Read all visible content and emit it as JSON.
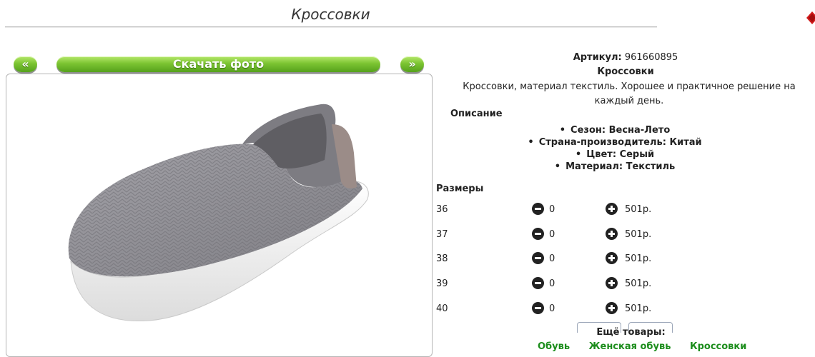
{
  "page": {
    "title": "Кроссовки"
  },
  "gallery": {
    "prev_label": "«",
    "next_label": "»",
    "download_label": "Скачать фото",
    "image_alt": "Кроссовки"
  },
  "product": {
    "article_label": "Артикул:",
    "article_value": "961660895",
    "name": "Кроссовки",
    "description": "Кроссовки, материал текстиль. Хорошее и практичное решение на каждый день.",
    "description_heading": "Описание",
    "features": [
      "Сезон: Весна-Лето",
      "Страна-производитель: Китай",
      "Цвет: Серый",
      "Материал: Текстиль"
    ]
  },
  "sizes": {
    "heading": "Размеры",
    "rows": [
      {
        "size": "36",
        "qty": "0",
        "price": "501р."
      },
      {
        "size": "37",
        "qty": "0",
        "price": "501р."
      },
      {
        "size": "38",
        "qty": "0",
        "price": "501р."
      },
      {
        "size": "39",
        "qty": "0",
        "price": "501р."
      },
      {
        "size": "40",
        "qty": "0",
        "price": "501р."
      }
    ]
  },
  "more": {
    "heading": "Ещё товары:",
    "links": [
      "Обувь",
      "Женская обувь",
      "Кроссовки"
    ]
  },
  "colors": {
    "accent_green": "#7cc432",
    "link_green": "#1c8d1c",
    "shoe_gray": "#8c8b90",
    "sole_white": "#f4f4f4"
  },
  "icons": {
    "minus": "minus-circle-icon",
    "plus": "plus-circle-icon"
  }
}
